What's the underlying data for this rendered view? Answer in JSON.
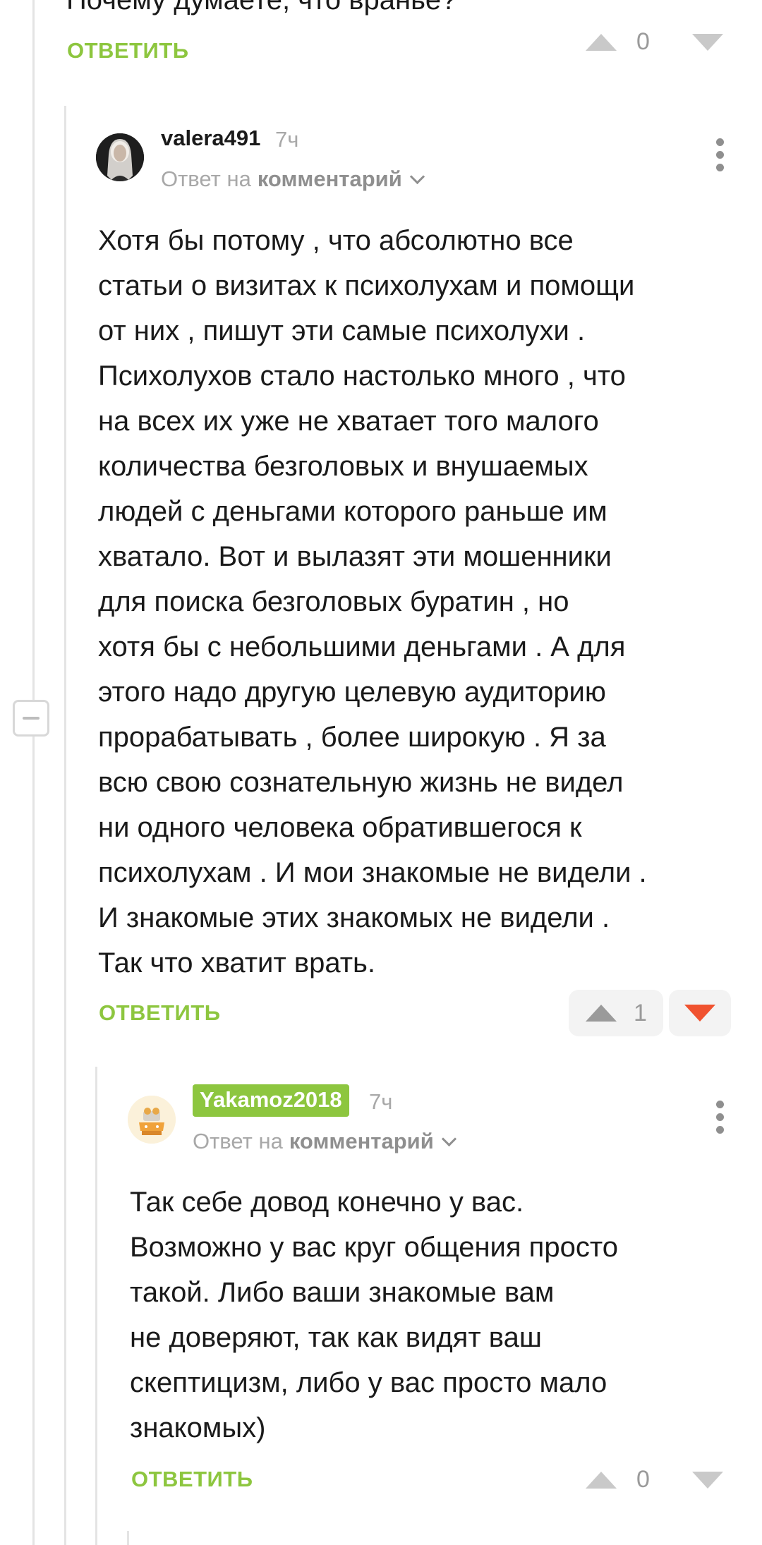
{
  "top_partial_text": "Почему думаете, что враньё?",
  "parent_comment": {
    "reply_label": "ОТВЕТИТЬ",
    "vote_count": "0"
  },
  "comment1": {
    "username": "valera491",
    "time": "7ч",
    "reply_to_prefix": "Ответ на",
    "reply_to_link": "комментарий",
    "text": "Хотя бы потому , что абсолютно все\nстатьи о  визитах к психолухам и помощи\nот них , пишут эти самые психолухи .\nПсихолухов стало настолько много , что\nна всех их уже не хватает того малого\nколичества безголовых и внушаемых\nлюдей с деньгами которого раньше им\nхватало. Вот и вылазят эти мошенники\nдля поиска безголовых буратин , но\nхотя бы с небольшими деньгами . А для\nэтого надо другую целевую аудиторию\nпрорабатывать , более широкую . Я за\nвсю свою сознательную жизнь не видел\nни одного человека обратившегося к\nпсихолухам . И мои знакомые не видели .\nИ знакомые этих знакомых не видели .\nТак что хватит врать.",
    "reply_label": "ОТВЕТИТЬ",
    "vote_count": "1",
    "downvoted": true
  },
  "comment2": {
    "username": "Yakamoz2018",
    "time": "7ч",
    "reply_to_prefix": "Ответ на",
    "reply_to_link": "комментарий",
    "text": "Так себе довод конечно у вас.\nВозможно у вас круг общения просто\nтакой. Либо ваши знакомые вам\nне доверяют, так как видят ваш\nскептицизм, либо у вас просто мало\nзнакомых)",
    "reply_label": "ОТВЕТИТЬ",
    "vote_count": "0"
  },
  "colors": {
    "accent_green": "#8dc63f",
    "downvote_red": "#f0522f",
    "muted_gray": "#a8a8a8"
  },
  "icons": [
    "upvote-icon",
    "downvote-icon",
    "more-options-icon",
    "chevron-down-icon",
    "collapse-thread-icon"
  ]
}
